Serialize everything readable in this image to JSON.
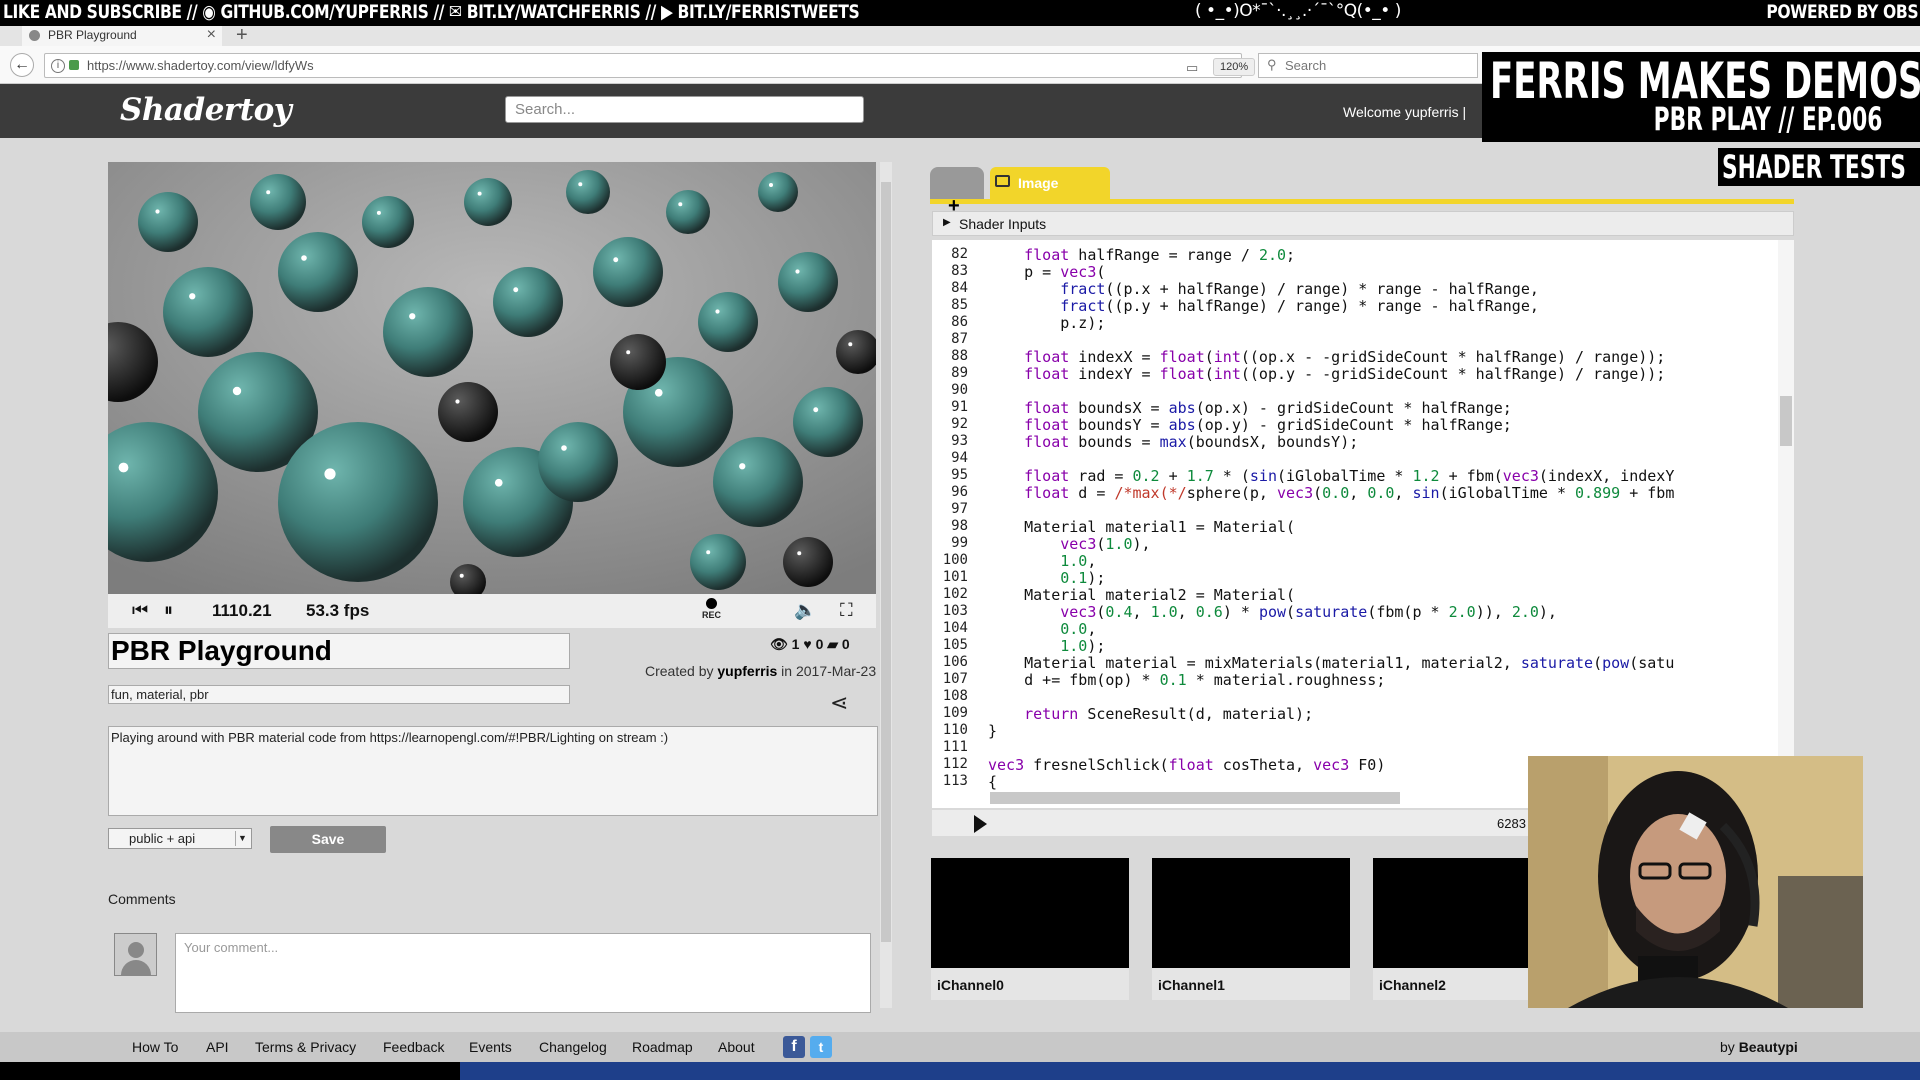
{
  "overlay": {
    "top_left": "LIKE AND SUBSCRIBE // ◉ GITHUB.COM/YUPFERRIS // ✉ BIT.LY/WATCHFERRIS // ▶ BIT.LY/FERRISTWEETS",
    "top_mid": "( •_•)O*¯`·.¸¸.·´¯`°Q(•_• )",
    "top_right": "POWERED BY OBS",
    "title": "FERRIS MAKES DEMOS",
    "subtitle": "PBR PLAY // EP.006",
    "tag": "SHADER TESTS"
  },
  "browser": {
    "tab_title": "PBR Playground",
    "url": "https://www.shadertoy.com/view/ldfyWs",
    "zoom": "120%",
    "search_placeholder": "Search"
  },
  "site": {
    "logo": "Shadertoy",
    "search_placeholder": "Search...",
    "welcome": "Welcome yupferris |"
  },
  "player": {
    "time": "1110.21",
    "fps": "53.3 fps",
    "rec_label": "REC"
  },
  "shader": {
    "title": "PBR Playground",
    "views": "1",
    "likes": "0",
    "comments": "0",
    "created_prefix": "Created by ",
    "author": "yupferris",
    "created_suffix": " in 2017-Mar-23",
    "tags": "fun, material, pbr",
    "description": "Playing around with PBR material code from https://learnopengl.com/#!PBR/Lighting on stream :)",
    "visibility": "public + api",
    "save_label": "Save",
    "comments_label": "Comments",
    "comment_placeholder": "Your comment..."
  },
  "editor": {
    "tab_label": "Image",
    "inputs_label": "Shader Inputs",
    "char_count": "6283",
    "line_numbers": [
      "82",
      "83",
      "84",
      "85",
      "86",
      "87",
      "88",
      "89",
      "90",
      "91",
      "92",
      "93",
      "94",
      "95",
      "96",
      "97",
      "98",
      "99",
      "100",
      "101",
      "102",
      "103",
      "104",
      "105",
      "106",
      "107",
      "108",
      "109",
      "110",
      "111",
      "112",
      "113"
    ]
  },
  "channels": [
    "iChannel0",
    "iChannel1",
    "iChannel2"
  ],
  "footer": {
    "links": [
      "How To",
      "API",
      "Terms & Privacy",
      "Feedback",
      "Events",
      "Changelog",
      "Roadmap",
      "About"
    ],
    "by_prefix": "by ",
    "by_name": "Beautypi"
  },
  "colors": {
    "accent_yellow": "#f2d52a",
    "header_bg": "#3b3b3b",
    "sphere_teal": "#4f8f8a"
  }
}
